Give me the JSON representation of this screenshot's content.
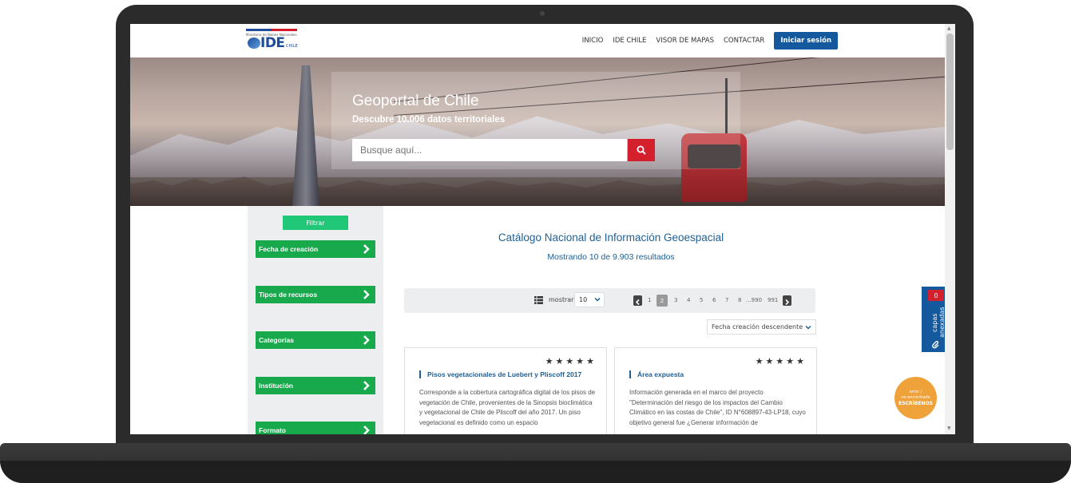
{
  "nav": {
    "logo_text": "IDE",
    "logo_sub": "CHILE",
    "logo_tiny": "Ministerio de Bienes Nacionales",
    "items": [
      "INICIO",
      "IDE CHILE",
      "VISOR DE MAPAS",
      "CONTACTAR"
    ],
    "login_label": "Iniciar sesión"
  },
  "hero": {
    "title": "Geoportal de Chile",
    "subtitle": "Descubre 10.006 datos territoriales",
    "search_placeholder": "Busque aquí...",
    "search_icon": "search-icon"
  },
  "sidebar": {
    "filter_label": "Filtrar",
    "facets": [
      "Fecha de creación",
      "Tipos de recursos",
      "Categorías",
      "Institución",
      "Formato"
    ]
  },
  "main": {
    "title": "Catálogo Nacional de Información Geoespacial",
    "count": "Mostrando 10 de 9.903 resultados",
    "show_label": "mostrar",
    "per_page": "10",
    "pages": [
      "1",
      "2",
      "3",
      "4",
      "5",
      "6",
      "7",
      "8",
      "...990",
      "991"
    ],
    "active_page": "2",
    "sort": "Fecha creación descendente"
  },
  "cards": [
    {
      "stars": "★★★★★",
      "title": "Pisos vegetacionales de Luebert y Pliscoff 2017",
      "desc": "Corresponde a la cobertura cartográfica digital de los pisos de vegetación de Chile, provenientes de la Sinopsis bioclimática y vegetacional de Chile de Pliscoff del año 2017. Un piso vegetacional es definido como un espacio"
    },
    {
      "stars": "★★★★★",
      "title": "Área expuesta",
      "desc": "Información generada en el marco del proyecto \"Determinación del riesgo de los impactos del Cambio Climático en las costas de Chile\", ID N°608897-43-LP18, cuyo objetivo general fue ¿Generar información de"
    }
  ],
  "widgets": {
    "layers_count": "0",
    "layers_label": "capas anexadas",
    "help_line1": "error /",
    "help_line2": "no encontrado",
    "help_cta": "ESCRÍBENOS"
  },
  "colors": {
    "brand_blue": "#14599e",
    "facet_green": "#19a94d",
    "filter_green": "#1fc777",
    "search_red": "#d4202c",
    "help_orange": "#f0a23a"
  }
}
